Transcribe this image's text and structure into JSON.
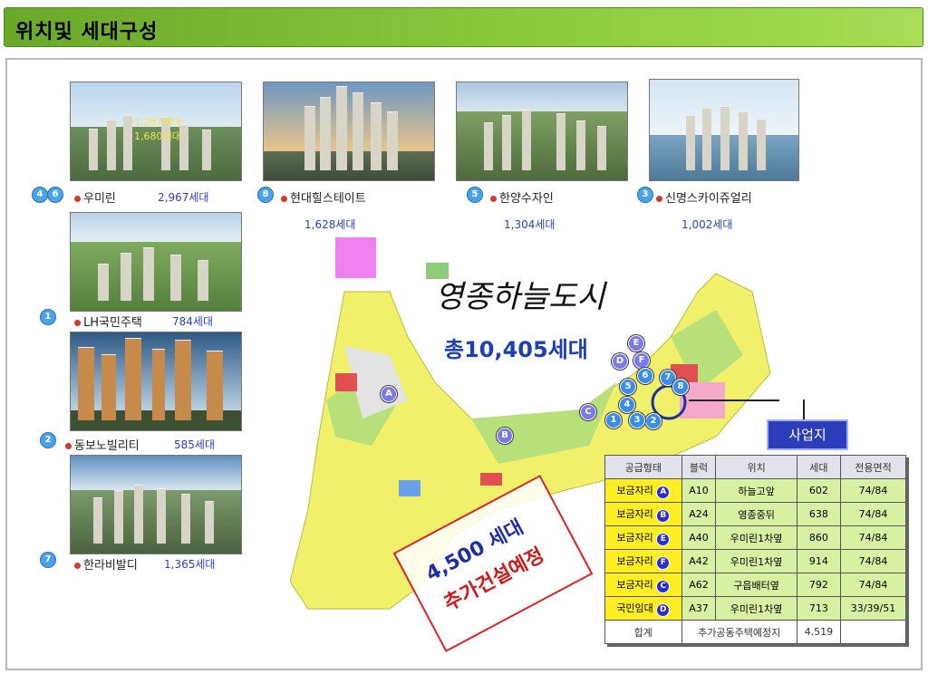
{
  "header": {
    "title": "위치및 세대구성"
  },
  "photos": {
    "p1": {
      "badge": "4 6",
      "name": "우미린",
      "count": "2,967세대",
      "overlay": [
        "1,287세대",
        "1,680세대"
      ]
    },
    "p2": {
      "badge": "8",
      "name": "현대힐스테이트",
      "count": "1,628세대"
    },
    "p3": {
      "badge": "5",
      "name": "한양수자인",
      "count": "1,304세대"
    },
    "p4": {
      "badge": "3",
      "name": "신명스카이쥬얼리",
      "count": "1,002세대"
    },
    "p5": {
      "badge": "1",
      "name": "LH국민주택",
      "count": "784세대"
    },
    "p6": {
      "badge": "2",
      "name": "동보노빌리티",
      "count": "585세대"
    },
    "p7": {
      "badge": "7",
      "name": "한라비발디",
      "count": "1,365세대"
    }
  },
  "map": {
    "title": "영종하늘도시",
    "total": "총10,405세대",
    "stamp_line1": "4,500 세대",
    "stamp_line2": "추가건설예정",
    "site_label": "사업지",
    "markers": [
      "A",
      "B",
      "C",
      "D",
      "E",
      "F",
      "1",
      "2",
      "3",
      "4",
      "5",
      "6",
      "7",
      "8"
    ]
  },
  "table": {
    "headers": [
      "공급형태",
      "블럭",
      "위치",
      "세대",
      "전용면적"
    ],
    "rows": [
      {
        "type": "보금자리",
        "ball": "A",
        "block": "A10",
        "loc": "하늘고앞",
        "units": "602",
        "area": "74/84"
      },
      {
        "type": "보금자리",
        "ball": "B",
        "block": "A24",
        "loc": "영종중뒤",
        "units": "638",
        "area": "74/84"
      },
      {
        "type": "보금자리",
        "ball": "E",
        "block": "A40",
        "loc": "우미린1차옆",
        "units": "860",
        "area": "74/84"
      },
      {
        "type": "보금자리",
        "ball": "F",
        "block": "A42",
        "loc": "우미린1차옆",
        "units": "914",
        "area": "74/84"
      },
      {
        "type": "보금자리",
        "ball": "C",
        "block": "A62",
        "loc": "구읍배터옆",
        "units": "792",
        "area": "74/84"
      },
      {
        "type": "국민임대",
        "ball": "D",
        "block": "A37",
        "loc": "우미린1차옆",
        "units": "713",
        "area": "33/39/51"
      }
    ],
    "total": {
      "label": "합계",
      "desc": "추가공동주택예정지",
      "units": "4,519"
    }
  },
  "colors": {
    "header_green": "#8ccc3c",
    "accent_blue": "#2b3db8",
    "stamp_red": "#d21a1a"
  }
}
